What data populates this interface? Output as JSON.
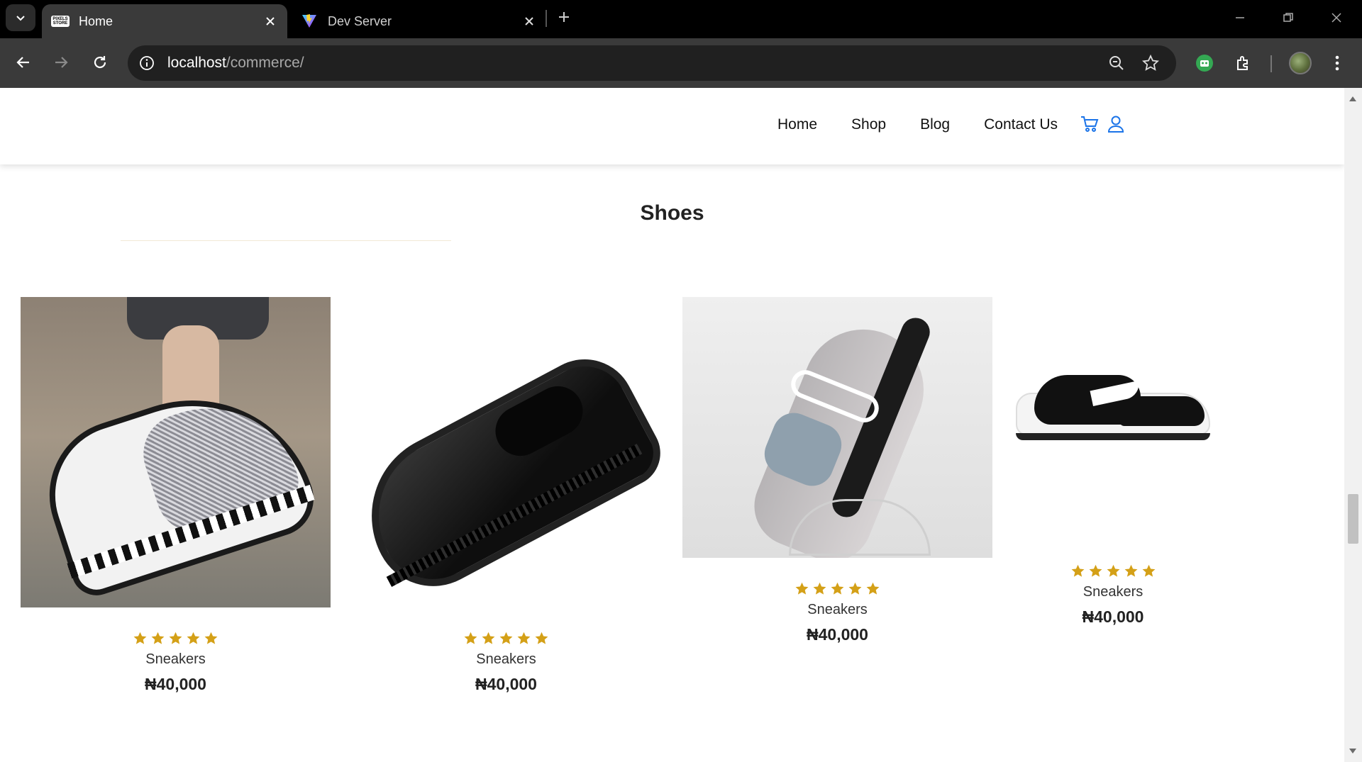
{
  "browser": {
    "tabs": [
      {
        "title": "Home",
        "active": true
      },
      {
        "title": "Dev Server",
        "active": false
      }
    ],
    "url_host": "localhost",
    "url_path": "/commerce/",
    "home_favicon_text": "PIXELS STORE"
  },
  "site": {
    "nav": [
      "Home",
      "Shop",
      "Blog",
      "Contact Us"
    ],
    "accent_color": "#1a73e8"
  },
  "section": {
    "title": "Shoes"
  },
  "products": [
    {
      "name": "Sneakers",
      "price": "₦40,000",
      "rating": 5
    },
    {
      "name": "Sneakers",
      "price": "₦40,000",
      "rating": 5
    },
    {
      "name": "Sneakers",
      "price": "₦40,000",
      "rating": 5
    },
    {
      "name": "Sneakers",
      "price": "₦40,000",
      "rating": 5
    }
  ],
  "star_color": "#d4a017"
}
